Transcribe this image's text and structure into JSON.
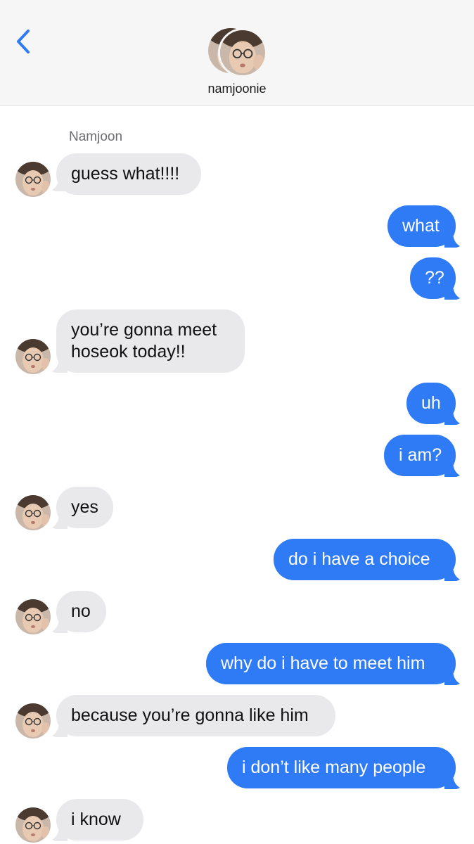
{
  "header": {
    "contact_name": "namjoonie"
  },
  "thread": {
    "sender_label": "Namjoon",
    "messages": [
      {
        "from": "Namjoon",
        "text": "guess what!!!!"
      },
      {
        "from": "me",
        "text": "what"
      },
      {
        "from": "me",
        "text": "??"
      },
      {
        "from": "Namjoon",
        "line1": "you’re gonna meet",
        "line2": "hoseok today!!"
      },
      {
        "from": "me",
        "text": "uh"
      },
      {
        "from": "me",
        "text": "i am?"
      },
      {
        "from": "Namjoon",
        "text": "yes"
      },
      {
        "from": "me",
        "text": "do i have a choice"
      },
      {
        "from": "Namjoon",
        "text": "no"
      },
      {
        "from": "me",
        "text": "why do i have to meet him"
      },
      {
        "from": "Namjoon",
        "text": "because you’re gonna like him"
      },
      {
        "from": "me",
        "text": "i don’t like many people"
      },
      {
        "from": "Namjoon",
        "text": "i know"
      }
    ]
  },
  "colors": {
    "outgoing_bubble": "#2f7bf5",
    "incoming_bubble": "#e9e9eb",
    "back_chevron": "#2f7bf5"
  },
  "icons": {
    "back": "chevron-left-icon",
    "avatar": "profile-photo"
  }
}
